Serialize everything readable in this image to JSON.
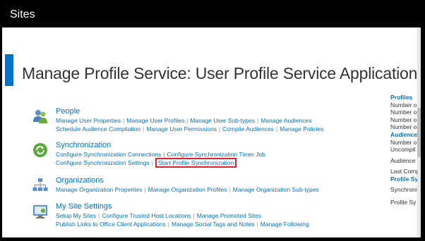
{
  "header": {
    "title": "Sites"
  },
  "page": {
    "title": "Manage Profile Service: User Profile Service Application"
  },
  "groups": {
    "people": {
      "title": "People",
      "line1": [
        "Manage User Properties",
        "Manage User Profiles",
        "Manage User Sub-types",
        "Manage Audiences"
      ],
      "line2": [
        "Schedule Audience Compilation",
        "Manage User Permissions",
        "Compile Audiences",
        "Manage Policies"
      ]
    },
    "sync": {
      "title": "Synchronization",
      "line1": [
        "Configure Synchronization Connections",
        "Configure Synchronization Timer Job"
      ],
      "line2": [
        "Configure Synchronization Settings",
        "Start Profile Synchronization"
      ]
    },
    "orgs": {
      "title": "Organizations",
      "line1": [
        "Manage Organization Properties",
        "Manage Organization Profiles",
        "Manage Organization Sub-types"
      ]
    },
    "mysite": {
      "title": "My Site Settings",
      "line1": [
        "Setup My Sites",
        "Configure Trusted Host Locations",
        "Manage Promoted Sites"
      ],
      "line2": [
        "Publish Links to Office Client Applications",
        "Manage Social Tags and Notes",
        "Manage Following"
      ]
    }
  },
  "right_panel": {
    "l0": "Profiles",
    "l1": "Number o",
    "l2": "Number o",
    "l3": "Number o",
    "l4": "Number o",
    "l5": "Audience",
    "l6": "Number o",
    "l7": "Uncompil",
    "l8": "Audience",
    "l9": "Last Comp",
    "l10": "Profile Sy",
    "l11": "Synchroni",
    "l12": "Profile Sy"
  },
  "colors": {
    "accent": "#0072c6",
    "header_bg": "#000000",
    "highlight": "#d9232e"
  }
}
